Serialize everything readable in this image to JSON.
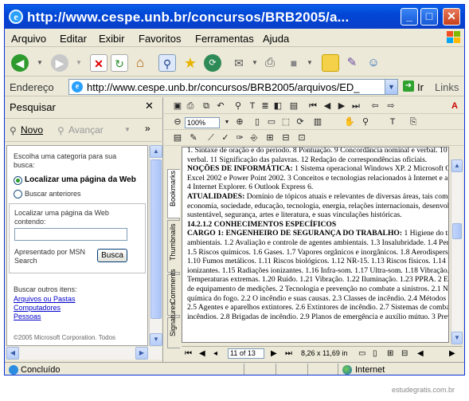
{
  "window": {
    "title": "http://www.cespe.unb.br/concursos/BRB2005/a..."
  },
  "titlebar_buttons": {
    "minimize": "_",
    "maximize": "□",
    "close": "✕"
  },
  "menu": [
    "Arquivo",
    "Editar",
    "Exibir",
    "Favoritos",
    "Ferramentas",
    "Ajuda"
  ],
  "address": {
    "label": "Endereço",
    "url": "http://www.cespe.unb.br/concursos/BRB2005/arquivos/ED_",
    "go": "Ir",
    "links": "Links"
  },
  "search_pane": {
    "title": "Pesquisar",
    "new_label": "Novo",
    "next_label": "Avançar",
    "choose_category": "Escolha uma categoria para sua busca:",
    "option_find_page": "Localizar uma página da Web",
    "option_prev_searches": "Buscar anteriores",
    "find_page_label": "Localizar uma página da Web contendo:",
    "search_input_value": "",
    "msn_label": "Apresentado por MSN Search",
    "search_button": "Busca",
    "other_items_label": "Buscar outros itens:",
    "links": [
      "Arquivos ou Pastas",
      "Computadores",
      "Pessoas"
    ],
    "copyright": "©2005 Microsoft Corporation. Todos"
  },
  "acrobat": {
    "zoom": "100%",
    "side_tabs": [
      "Bookmarks",
      "Thumbnails",
      "Comments",
      "Signatures"
    ],
    "page_indicator": "11 of 13",
    "page_size": "8,26 x 11,69 in"
  },
  "document": {
    "lines": [
      {
        "text": "1. Sintaxe de oração e do período. 8 Pontuação. 9 Concordância nominal e verbal. 10 Regência nominal e",
        "bold": false
      },
      {
        "text": "verbal. 11 Significação das palavras. 12 Redação de correspondências oficiais.",
        "bold": false
      },
      {
        "lead": "NOÇÕES DE INFORMÁTICA:",
        "text": " 1 Sistema operacional Windows XP. 2 Microsoft Office: Word,",
        "bold": false
      },
      {
        "text": "Excel 2002 e Power Point 2002. 3 Conceitos e tecnologias relacionados à Internet e a Intranet.",
        "bold": false
      },
      {
        "text": "4 Internet Explorer. 6 Outlook Express 6.",
        "bold": false
      },
      {
        "lead": "ATUALIDADES:",
        "text": " Domínio de tópicos atuais e relevantes de diversas áreas, tais como política,",
        "bold": false
      },
      {
        "text": "economia, sociedade, educação, tecnologia, energia, relações internacionais, desenvolvimento",
        "bold": false
      },
      {
        "text": "sustentável, segurança, artes e literatura, e suas vinculações históricas.",
        "bold": false
      },
      {
        "text": "14.2.1.2 CONHECIMENTOS ESPECÍFICOS",
        "bold": true
      },
      {
        "lead": "CARGO 1: ENGENHEIRO DE SEGURANÇA DO TRABALHO:",
        "text": " 1 Higiene do trabalho. 1.1 Riscos",
        "bold": false
      },
      {
        "text": "ambientais. 1.2 Avaliação e controle de agentes ambientais. 1.3 Insalubridade. 1.4 Periculosidade.",
        "bold": false
      },
      {
        "text": "1.5 Riscos químicos. 1.6 Gases. 1.7 Vapores orgânicos e inorgânicos. 1.8 Aerodispersóides.",
        "bold": false
      },
      {
        "text": "1.10 Fumos metálicos. 1.11 Riscos biológicos. 1.12 NR-15. 1.13 Riscos físicos. 1.14 Radiações",
        "bold": false
      },
      {
        "text": "ionizantes. 1.15 Radiações ionizantes. 1.16 Infra-som. 1.17 Ultra-som. 1.18 Vibração. 1.19",
        "bold": false
      },
      {
        "text": "Temperaturas extremas. 1.20 Ruído. 1.21 Vibração. 1.22 Iluminação. 1.23 PPRA. 2 Equipamentos",
        "bold": false
      },
      {
        "text": "de equipamento de medições. 2 Tecnologia e prevenção no combate a sinistros. 2.1 Noções de",
        "bold": false
      },
      {
        "text": "química do fogo. 2.2 O incêndio e suas causas. 2.3 Classes de incêndio. 2.4 Métodos de extinção.",
        "bold": false
      },
      {
        "text": "2.5 Agentes e aparelhos extintores. 2.6 Extintores de incêndio. 2.7 Sistemas de combate a",
        "bold": false
      },
      {
        "text": "incêndios. 2.8 Brigadas de incêndio. 2.9 Planos de emergência e auxílio mútuo. 3 Prevenção",
        "bold": false
      }
    ]
  },
  "status": {
    "text": "Concluído",
    "zone": "Internet"
  },
  "watermark": "estudegratis.com.br",
  "colors": {
    "titlebar": "#0146d6",
    "chrome": "#ece9d8",
    "link": "#0000cc"
  }
}
